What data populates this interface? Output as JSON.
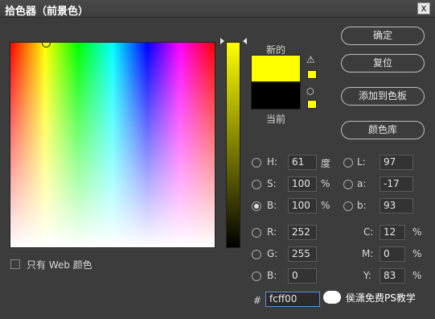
{
  "window": {
    "title": "拾色器（前景色）",
    "close_glyph": "x"
  },
  "color_field": {
    "hue_color": "#ffff00"
  },
  "swatches": {
    "new_label": "新的",
    "current_label": "当前",
    "new_color": "#ffff00",
    "current_color": "#000000"
  },
  "buttons": {
    "ok": "确定",
    "reset": "复位",
    "add_to_swatches": "添加到色板",
    "color_libraries": "颜色库"
  },
  "hsb": {
    "h": {
      "label": "H:",
      "value": "61",
      "unit": "度"
    },
    "s": {
      "label": "S:",
      "value": "100",
      "unit": "%"
    },
    "b": {
      "label": "B:",
      "value": "100",
      "unit": "%"
    }
  },
  "rgb": {
    "r": {
      "label": "R:",
      "value": "252"
    },
    "g": {
      "label": "G:",
      "value": "255"
    },
    "b": {
      "label": "B:",
      "value": "0"
    }
  },
  "lab": {
    "l": {
      "label": "L:",
      "value": "97"
    },
    "a": {
      "label": "a:",
      "value": "-17"
    },
    "b": {
      "label": "b:",
      "value": "93"
    }
  },
  "cmyk": {
    "c": {
      "label": "C:",
      "value": "12",
      "unit": "%"
    },
    "m": {
      "label": "M:",
      "value": "0",
      "unit": "%"
    },
    "y": {
      "label": "Y:",
      "value": "83",
      "unit": "%"
    },
    "k": {
      "label": "K:",
      "value": "0",
      "unit": "%"
    }
  },
  "hex": {
    "label": "#",
    "value": "fcff00"
  },
  "web_only": {
    "label": "只有 Web 颜色",
    "checked": false
  },
  "watermark": {
    "text": "侯潇免费PS教学"
  },
  "icons": {
    "gamut_warning": "warning-triangle-icon",
    "web_safe": "cube-icon"
  }
}
